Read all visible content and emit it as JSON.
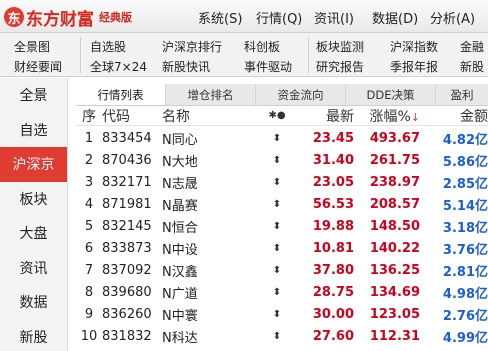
{
  "app": {
    "logo_char": "东",
    "title": "东方财富",
    "badge": "经典版"
  },
  "top_menu": [
    "系统(S)",
    "行情(Q)",
    "资讯(I)",
    "数据(D)",
    "分析(A)"
  ],
  "toolbar": {
    "row1": [
      "全景图",
      "自选股",
      "沪深京排行",
      "科创板",
      "板块监测",
      "沪深指数",
      "金融"
    ],
    "row2": [
      "财经要闻",
      "全球7×24",
      "新股快讯",
      "事件驱动",
      "研究报告",
      "季报年报",
      "新股"
    ]
  },
  "sidebar": {
    "items": [
      "全景",
      "自选",
      "沪深京",
      "板块",
      "大盘",
      "资讯",
      "数据",
      "新股"
    ],
    "active": "沪深京"
  },
  "tabs": [
    "行情列表",
    "增仓排名",
    "资金流向",
    "DDE决策",
    "盈利"
  ],
  "table": {
    "headers": {
      "no": "序",
      "code": "代码",
      "name": "名称",
      "mark": "✱●",
      "price": "最新",
      "chg": "涨幅%",
      "amount": "金额"
    },
    "sort_indicator": "↓",
    "rows": [
      {
        "no": "1",
        "code": "833454",
        "name": "N同心",
        "mark": "⬍",
        "price": "23.45",
        "chg": "493.67",
        "amount": "4.82亿"
      },
      {
        "no": "2",
        "code": "870436",
        "name": "N大地",
        "mark": "⬍",
        "price": "31.40",
        "chg": "261.75",
        "amount": "5.86亿"
      },
      {
        "no": "3",
        "code": "832171",
        "name": "N志晟",
        "mark": "⬍",
        "price": "23.05",
        "chg": "238.97",
        "amount": "2.85亿"
      },
      {
        "no": "4",
        "code": "871981",
        "name": "N晶赛",
        "mark": "⬍",
        "price": "56.53",
        "chg": "208.57",
        "amount": "5.14亿"
      },
      {
        "no": "5",
        "code": "832145",
        "name": "N恒合",
        "mark": "⬍",
        "price": "19.88",
        "chg": "148.50",
        "amount": "3.18亿"
      },
      {
        "no": "6",
        "code": "833873",
        "name": "N中设",
        "mark": "⬍",
        "price": "10.81",
        "chg": "140.22",
        "amount": "3.76亿"
      },
      {
        "no": "7",
        "code": "837092",
        "name": "N汉鑫",
        "mark": "⬍",
        "price": "37.80",
        "chg": "136.25",
        "amount": "2.81亿"
      },
      {
        "no": "8",
        "code": "839680",
        "name": "N广道",
        "mark": "⬍",
        "price": "28.75",
        "chg": "134.69",
        "amount": "4.98亿"
      },
      {
        "no": "9",
        "code": "836260",
        "name": "N中寰",
        "mark": "⬍",
        "price": "30.00",
        "chg": "123.05",
        "amount": "2.76亿"
      },
      {
        "no": "10",
        "code": "831832",
        "name": "N科达",
        "mark": "⬍",
        "price": "27.60",
        "chg": "112.31",
        "amount": "4.99亿"
      }
    ]
  },
  "colors": {
    "brand": "#d8271c",
    "up": "#d0021b",
    "amount": "#1a5fd6",
    "active_bg": "#e03c31"
  }
}
